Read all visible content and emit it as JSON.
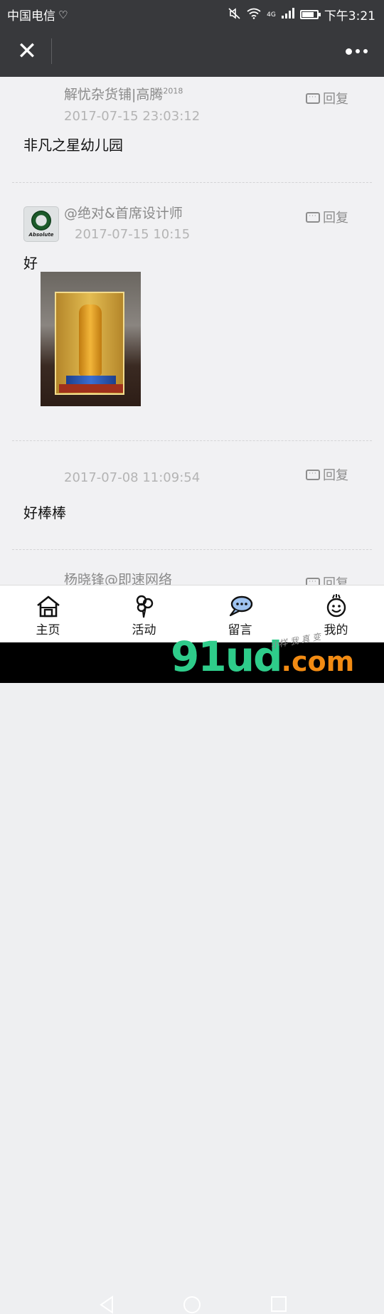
{
  "status_bar": {
    "carrier": "中国电信",
    "time": "下午3:21",
    "network": "4G",
    "battery_level": 0.75
  },
  "nav": {
    "close_icon": "close-icon",
    "more_icon": "more-icon"
  },
  "comments": [
    {
      "user": "解忧杂货铺|高腾",
      "user_suffix": "2018",
      "time": "2017-07-15 23:03:12",
      "text": "非凡之星幼儿园",
      "reply_label": "回复"
    },
    {
      "user": "@绝对&首席设计师",
      "avatar_text": "Absolute",
      "time": "2017-07-15 10:15",
      "text": "好",
      "reply_label": "回复",
      "has_image": true
    },
    {
      "user": "",
      "time": "2017-07-08 11:09:54",
      "text": "好棒棒",
      "reply_label": "回复"
    },
    {
      "user": "杨晓锋@即速网络",
      "reply_label": "回复"
    }
  ],
  "tabs": [
    {
      "label": "主页",
      "icon": "home-icon"
    },
    {
      "label": "活动",
      "icon": "balloon-icon"
    },
    {
      "label": "留言",
      "icon": "chat-bubble-icon",
      "accent": "#9fc3f0"
    },
    {
      "label": "我的",
      "icon": "smiley-icon"
    }
  ],
  "watermark": {
    "main": "91ud",
    "suffix": ".com",
    "small": "小样 我 真 变"
  }
}
